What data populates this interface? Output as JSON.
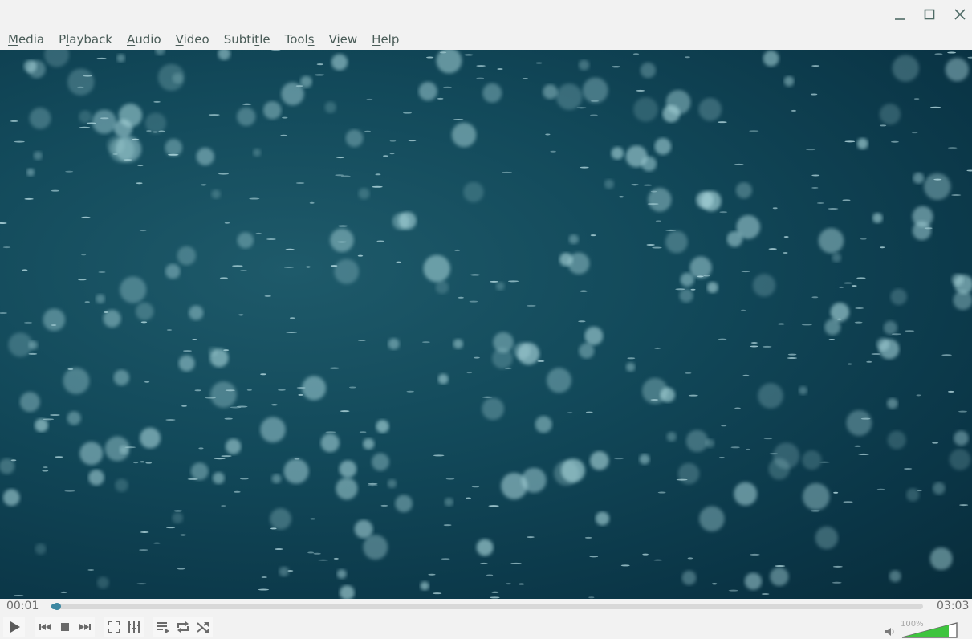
{
  "window": {
    "buttons": [
      "minimize",
      "maximize",
      "close"
    ]
  },
  "menu": [
    {
      "label": "Media",
      "accel": "M",
      "rest": "edia",
      "pre": ""
    },
    {
      "label": "Playback",
      "pre": "P",
      "accel": "l",
      "rest": "ayback"
    },
    {
      "label": "Audio",
      "pre": "",
      "accel": "A",
      "rest": "udio"
    },
    {
      "label": "Video",
      "pre": "",
      "accel": "V",
      "rest": "ideo"
    },
    {
      "label": "Subtitle",
      "pre": "Subti",
      "accel": "t",
      "rest": "le"
    },
    {
      "label": "Tools",
      "pre": "Tool",
      "accel": "s",
      "rest": ""
    },
    {
      "label": "View",
      "pre": "V",
      "accel": "i",
      "rest": "ew"
    },
    {
      "label": "Help",
      "pre": "",
      "accel": "H",
      "rest": "elp"
    }
  ],
  "player": {
    "elapsed": "00:01",
    "total": "03:03",
    "progress_fraction": 0.005,
    "volume_label": "100%",
    "volume_fraction": 1.0,
    "accent_color": "#3d88a2",
    "volume_color": "#3ec43e"
  },
  "controls": {
    "play": "play-icon",
    "previous": "skip-previous-icon",
    "stop": "stop-icon",
    "next": "skip-next-icon",
    "fullscreen": "fullscreen-icon",
    "extended": "equalizer-icon",
    "playlist": "playlist-icon",
    "loop": "loop-icon",
    "shuffle": "shuffle-icon",
    "mute": "speaker-icon"
  }
}
